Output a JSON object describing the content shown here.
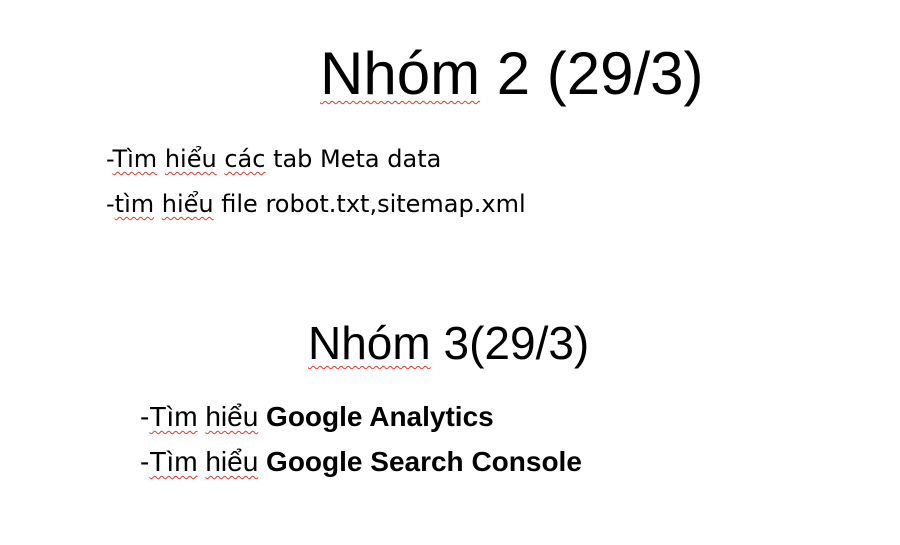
{
  "group2": {
    "title_word": "Nhóm",
    "title_rest": " 2 (29/3)",
    "items": [
      {
        "prefix": "-",
        "w1": "Tìm",
        "sp1": " ",
        "w2": "hiểu",
        "sp2": " ",
        "w3": "các",
        "rest": " tab Meta data"
      },
      {
        "prefix": "-",
        "w1": "tìm",
        "sp1": " ",
        "w2": "hiểu",
        "rest": " file robot.txt,sitemap.xml"
      }
    ]
  },
  "group3": {
    "title_word": "Nhóm",
    "title_rest": " 3(29/3)",
    "items": [
      {
        "prefix": "-",
        "w1": "Tìm",
        "sp1": " ",
        "w2": "hiểu",
        "sp2": " ",
        "bold": "Google Analytics"
      },
      {
        "prefix": "-",
        "w1": "Tìm",
        "sp1": " ",
        "w2": "hiểu",
        "sp2": " ",
        "bold": "Google Search Console"
      }
    ]
  },
  "colors": {
    "text": "#000000",
    "spellcheck_underline": "#e0392b",
    "background": "#ffffff"
  }
}
